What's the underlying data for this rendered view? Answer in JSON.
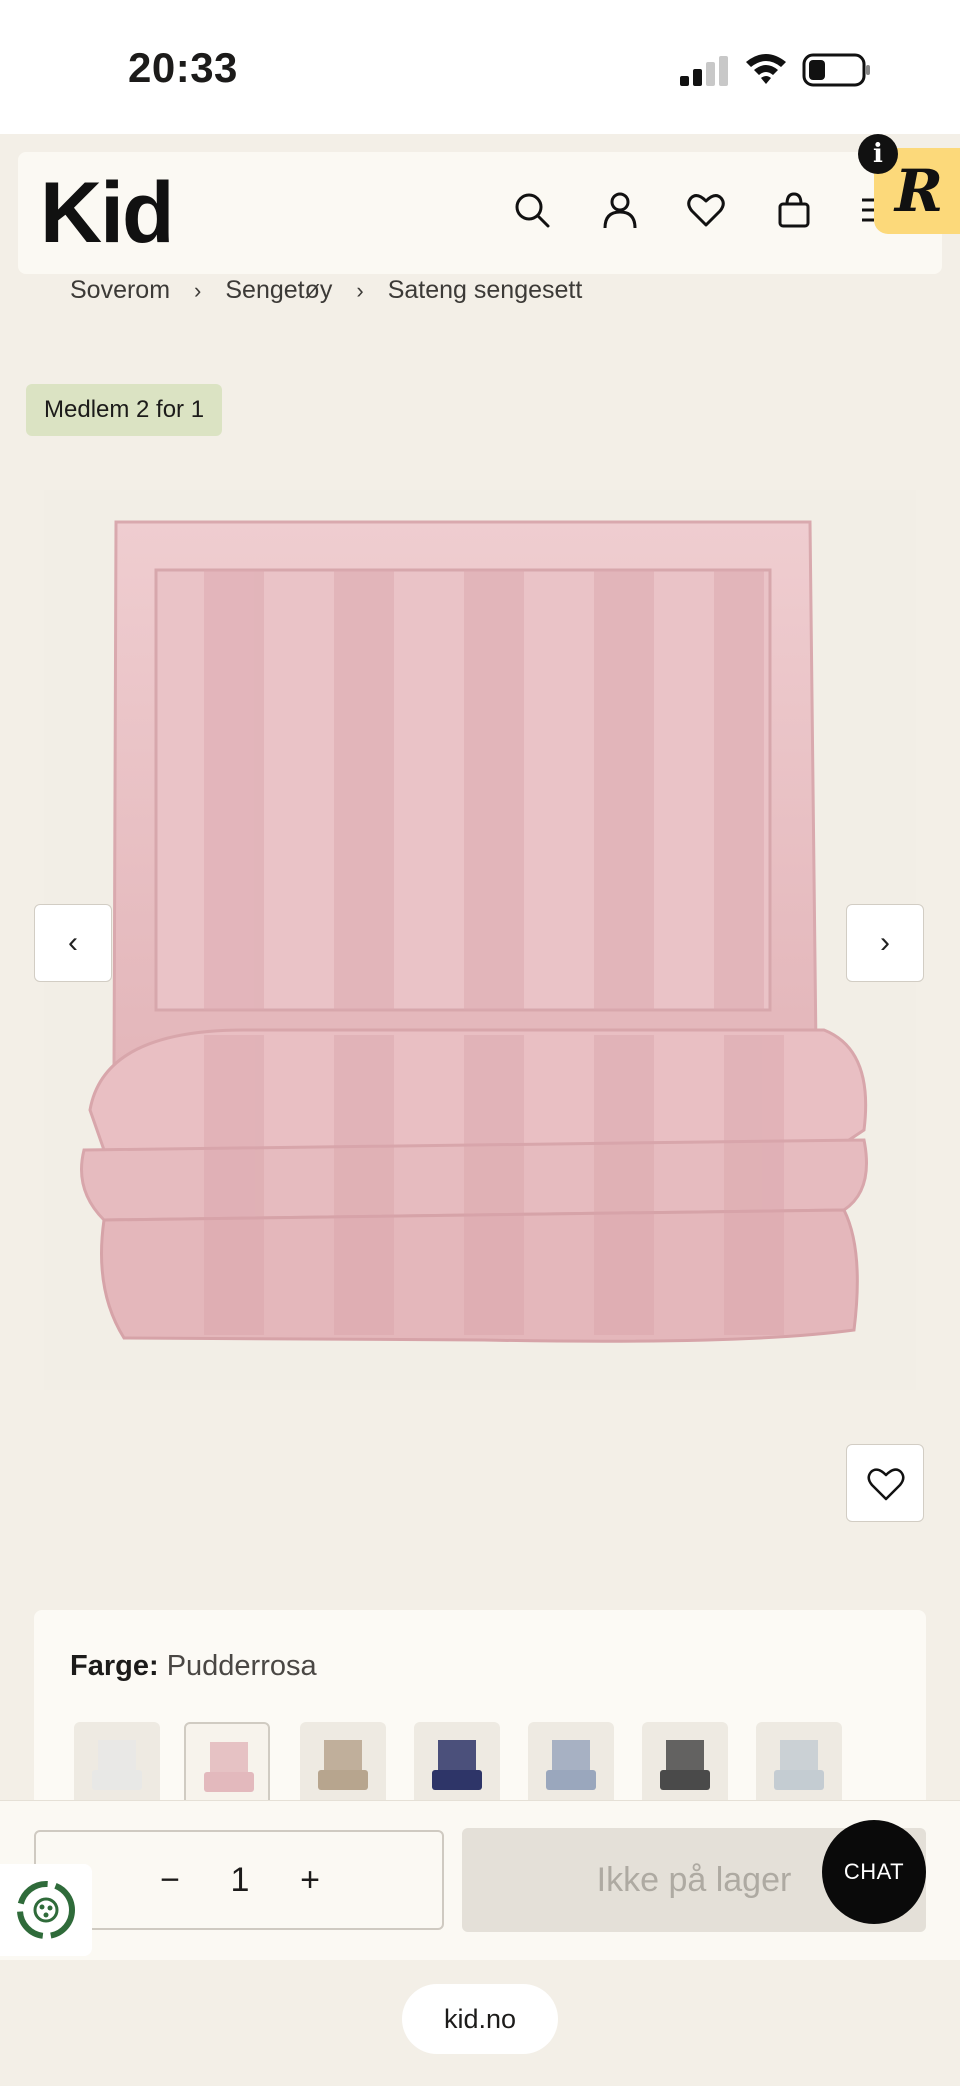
{
  "status_bar": {
    "time": "20:33"
  },
  "header": {
    "logo": "Kid",
    "badge_letter": "R",
    "info_letter": "i"
  },
  "breadcrumb": [
    "Soverom",
    "Sengetøy",
    "Sateng sengesett"
  ],
  "breadcrumb_separator": "›",
  "tag": "Medlem 2 for 1",
  "gallery": {
    "prev": "‹",
    "next": "›"
  },
  "product": {
    "color_key": "Farge:",
    "color_value": "Pudderrosa",
    "swatches": [
      {
        "name": "Hvit",
        "color": "#e8e8e6"
      },
      {
        "name": "Pudderrosa",
        "color": "#e3b9bd",
        "selected": true
      },
      {
        "name": "Beige",
        "color": "#b7a58e"
      },
      {
        "name": "Marine",
        "color": "#2e3568"
      },
      {
        "name": "Lys blå",
        "color": "#9aa7bd"
      },
      {
        "name": "Grå",
        "color": "#4a4a4a"
      },
      {
        "name": "Lys grå",
        "color": "#c4ccd2"
      }
    ]
  },
  "purchase": {
    "qty_minus": "−",
    "quantity": "1",
    "qty_plus": "+",
    "stock_label": "Ikke på lager"
  },
  "chat_label": "CHAT",
  "browser": {
    "url": "kid.no"
  }
}
